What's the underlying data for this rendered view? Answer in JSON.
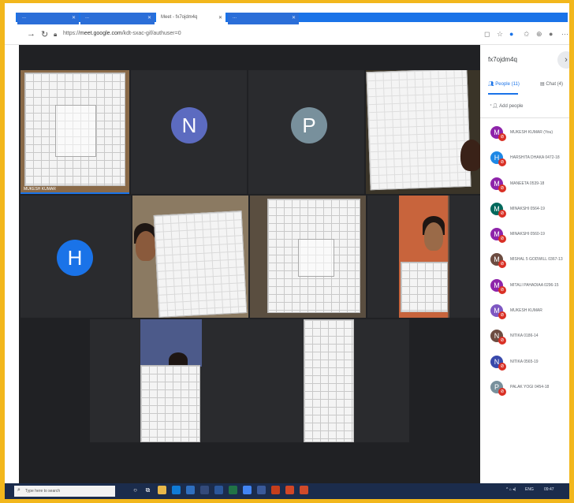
{
  "browser": {
    "tabs": [
      {
        "label": "...",
        "active": false
      },
      {
        "label": "...",
        "active": false
      },
      {
        "label": "Meet - fx7ojdm4q",
        "active": true
      },
      {
        "label": "...",
        "active": false
      }
    ],
    "url_prefix": "https://",
    "url_host": "meet.google.com",
    "url_path": "/kdt-sxac-gif/authuser=0"
  },
  "meet": {
    "tiles": [
      {
        "type": "video",
        "caption": "MUKESH KUMAR"
      },
      {
        "type": "avatar",
        "initial": "N",
        "color": "#5c6bc0"
      },
      {
        "type": "avatar",
        "initial": "P",
        "color": "#78909c"
      },
      {
        "type": "video"
      },
      {
        "type": "avatar",
        "initial": "H",
        "color": "#1a73e8"
      },
      {
        "type": "video"
      },
      {
        "type": "video"
      },
      {
        "type": "video"
      },
      {
        "type": "video"
      },
      {
        "type": "video"
      }
    ]
  },
  "panel": {
    "meeting_code": "fx7ojdm4q",
    "close_icon": "chevron-right-icon",
    "people_tab": "People (11)",
    "chat_tab": "Chat (4)",
    "add_people": "Add people",
    "participants": [
      {
        "name": "MUKESH KUMAR (You)",
        "initial": "M",
        "color": "#8e24aa"
      },
      {
        "name": "HARSHITA DHAKA 0472-18",
        "initial": "H",
        "color": "#1e88e5"
      },
      {
        "name": "MANEETA 0539-18",
        "initial": "M",
        "color": "#8e24aa"
      },
      {
        "name": "MINAKSHI 0564-19",
        "initial": "M",
        "color": "#00695c"
      },
      {
        "name": "MINAKSHI 0560-19",
        "initial": "M",
        "color": "#8e24aa"
      },
      {
        "name": "MISHAL 5 GODWILL 0367-13",
        "initial": "M",
        "color": "#6d4c41"
      },
      {
        "name": "MITALI PAHADIAA 0296-15",
        "initial": "M",
        "color": "#8e24aa"
      },
      {
        "name": "MUKESH KUMAR",
        "initial": "M",
        "color": "#7e57c2"
      },
      {
        "name": "NITIKA 0186-14",
        "initial": "N",
        "color": "#6d4c41"
      },
      {
        "name": "NITIKA 0565-19",
        "initial": "N",
        "color": "#3949ab"
      },
      {
        "name": "PALAK YOGI 0454-18",
        "initial": "P",
        "color": "#78909c"
      }
    ]
  },
  "taskbar": {
    "search_placeholder": "Type here to search",
    "time": "09:47",
    "tray_text": "ENG"
  },
  "colors": {
    "border": "#f2b71c",
    "meet_bg": "#202124",
    "accent": "#1a73e8"
  }
}
